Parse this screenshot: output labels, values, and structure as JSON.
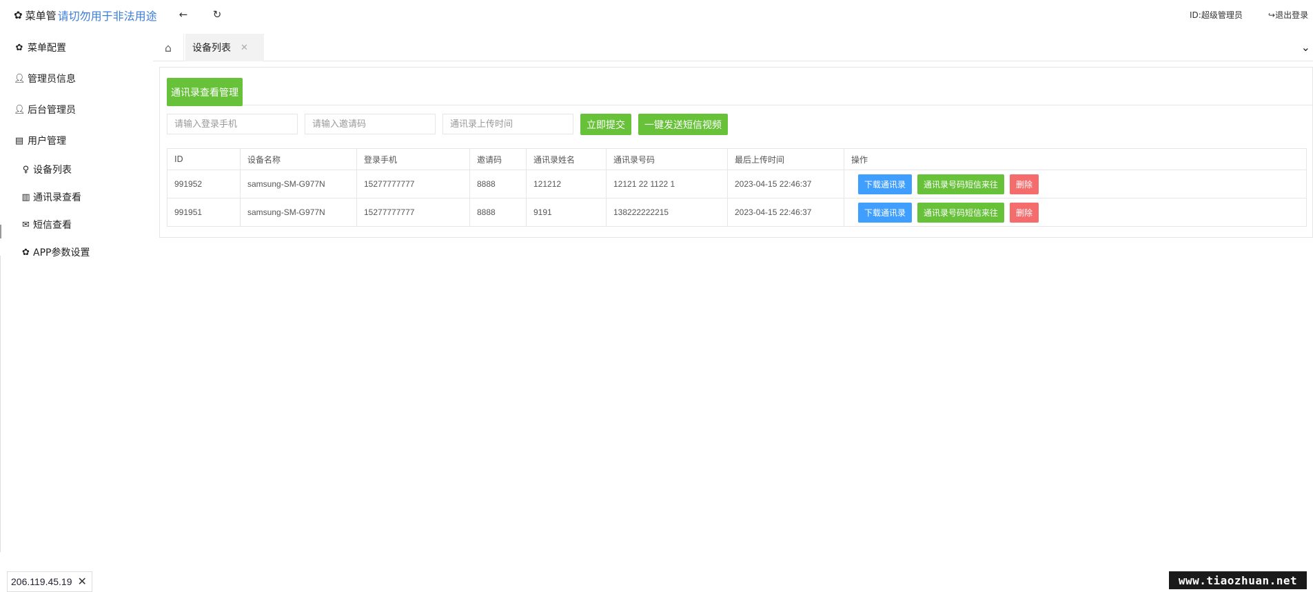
{
  "header": {
    "brand_label": "菜单管",
    "brand_icon": "gear-icon",
    "notice": "请切勿用于非法用途",
    "back_icon": "arrow-left-icon",
    "refresh_icon": "refresh-icon",
    "user_id": "ID:超级管理员",
    "logout": "退出登录",
    "logout_icon": "sign-out-icon"
  },
  "sidebar": {
    "items": [
      {
        "label": "菜单配置",
        "icon": "gear-icon"
      },
      {
        "label": "管理员信息",
        "icon": "user-icon"
      },
      {
        "label": "后台管理员",
        "icon": "user-icon"
      },
      {
        "label": "用户管理",
        "icon": "id-card-icon"
      }
    ],
    "subitems": [
      {
        "label": "设备列表",
        "icon": "user-outline-icon"
      },
      {
        "label": "通讯录查看",
        "icon": "book-icon"
      },
      {
        "label": "短信查看",
        "icon": "envelope-icon"
      },
      {
        "label": "APP参数设置",
        "icon": "gear-icon"
      }
    ]
  },
  "tabs": {
    "home_icon": "home-icon",
    "active_label": "设备列表",
    "close_icon": "close-icon",
    "more_icon": "chevron-down-icon"
  },
  "card": {
    "title": "通讯录查看管理",
    "filters": {
      "phone_placeholder": "请输入登录手机",
      "invite_placeholder": "请输入邀请码",
      "time_placeholder": "通讯录上传时间"
    },
    "submit_label": "立即提交",
    "sms_label": "一键发送短信视频"
  },
  "table": {
    "columns": [
      "ID",
      "设备名称",
      "登录手机",
      "邀请码",
      "通讯录姓名",
      "通讯录号码",
      "最后上传时间",
      "操作"
    ],
    "rows": [
      {
        "id": "991952",
        "device": "samsung-SM-G977N",
        "phone": "15277777777",
        "invite": "8888",
        "name": "121212",
        "number": "12121 22 1122 1",
        "time": "2023-04-15 22:46:37"
      },
      {
        "id": "991951",
        "device": "samsung-SM-G977N",
        "phone": "15277777777",
        "invite": "8888",
        "name": "9191",
        "number": "138222222215",
        "time": "2023-04-15 22:46:37"
      }
    ],
    "actions": {
      "download": "下载通讯录",
      "sms": "通讯录号码短信来往",
      "delete": "删除"
    }
  },
  "ip_badge": {
    "ip": "206.119.45.19",
    "close_icon": "close-icon"
  },
  "watermark": "www.tiaozhuan.net",
  "colors": {
    "green": "#67c23a",
    "blue": "#409eff",
    "red": "#f56c6c",
    "notice_blue": "#3b7dd8"
  }
}
